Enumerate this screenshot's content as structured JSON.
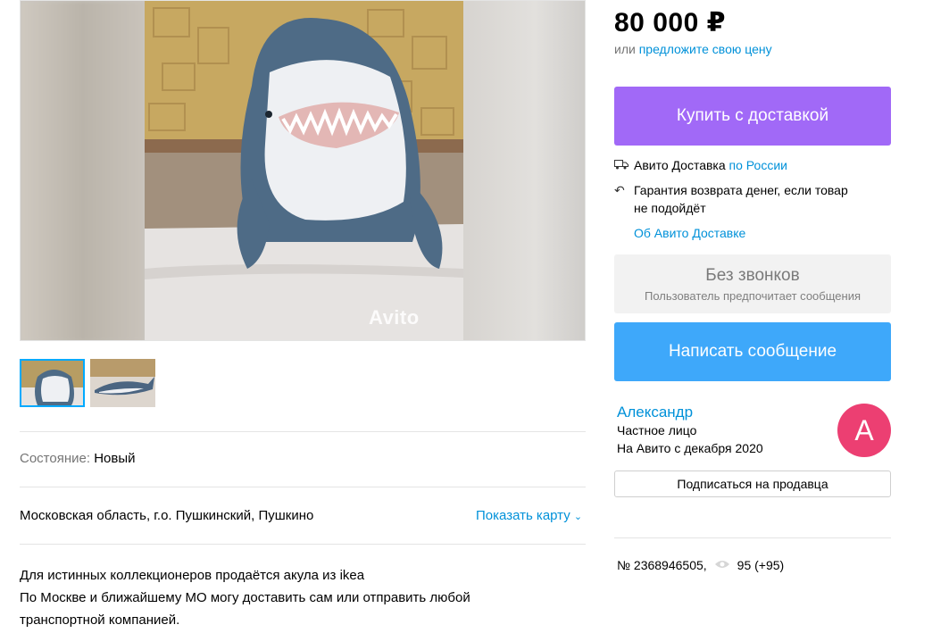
{
  "gallery": {
    "watermark": "Avito",
    "thumbnails": [
      {
        "name": "thumb-shark-front",
        "active": true
      },
      {
        "name": "thumb-shark-side",
        "active": false
      }
    ]
  },
  "params": {
    "condition_label": "Состояние:",
    "condition_value": "Новый"
  },
  "location": {
    "address": "Московская область, г.о. Пушкинский, Пушкино",
    "map_link": "Показать карту"
  },
  "description": {
    "line1": "Для истинных коллекционеров продаётся акула из ikea",
    "line2": "По Москве и ближайшему МО могу доставить сам или отправить любой",
    "line3": "транспортной компанией."
  },
  "pricing": {
    "price": "80 000 ₽",
    "offer_prefix": "или",
    "offer_link": "предложите свою цену"
  },
  "actions": {
    "buy_button": "Купить с доставкой",
    "nocall_title": "Без звонков",
    "nocall_subtitle": "Пользователь предпочитает сообщения",
    "message_button": "Написать сообщение",
    "subscribe_button": "Подписаться на продавца"
  },
  "delivery": {
    "delivery_text": "Авито Доставка",
    "delivery_link": "по России",
    "guarantee_line1": "Гарантия возврата денег, если товар",
    "guarantee_line2": "не подойдёт",
    "about_link": "Об Авито Доставке"
  },
  "seller": {
    "name": "Александр",
    "type": "Частное лицо",
    "since": "На Авито с декабря 2020",
    "avatar_letter": "А"
  },
  "listing": {
    "number": "№ 2368946505,",
    "views": "95 (+95)"
  },
  "colors": {
    "buy": "#a169f7",
    "message": "#3ea8fa",
    "link": "#0091d9",
    "avatar": "#ec3f72"
  }
}
